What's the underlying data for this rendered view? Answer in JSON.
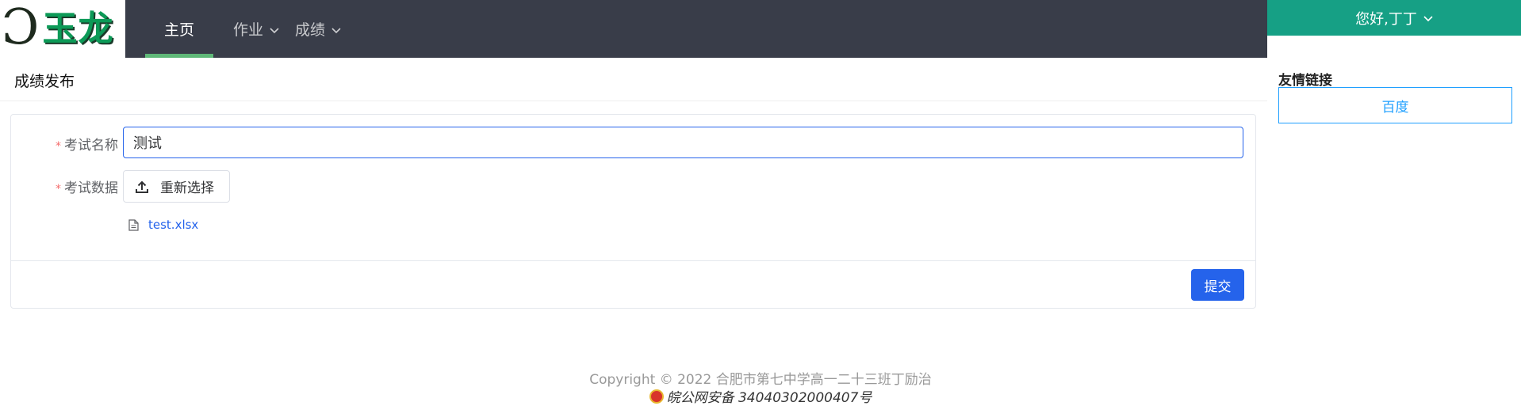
{
  "brand": {
    "logo_text": "玉龙"
  },
  "nav": {
    "items": [
      {
        "label": "主页",
        "active": true
      },
      {
        "label": "作业",
        "has_dropdown": true
      },
      {
        "label": "成绩",
        "has_dropdown": true
      }
    ],
    "user_label": "您好,丁丁"
  },
  "page": {
    "title": "成绩发布"
  },
  "form": {
    "name_label": "考试名称",
    "name_value": "测试",
    "data_label": "考试数据",
    "upload_label": "重新选择",
    "file_name": "test.xlsx",
    "submit_label": "提交"
  },
  "sidebar": {
    "links_title": "友情链接",
    "links": [
      {
        "label": "百度"
      }
    ]
  },
  "footer": {
    "copyright": "Copyright © 2022 合肥市第七中学高一二十三班丁励治",
    "icp": "皖公网安备 34040302000407号"
  },
  "colors": {
    "nav_bg": "#393d49",
    "nav_active_underline": "#5fb878",
    "user_btn_bg": "#16a085",
    "primary": "#2563eb",
    "link_blue": "#1e9fff",
    "logo_green": "#0c9a57"
  }
}
